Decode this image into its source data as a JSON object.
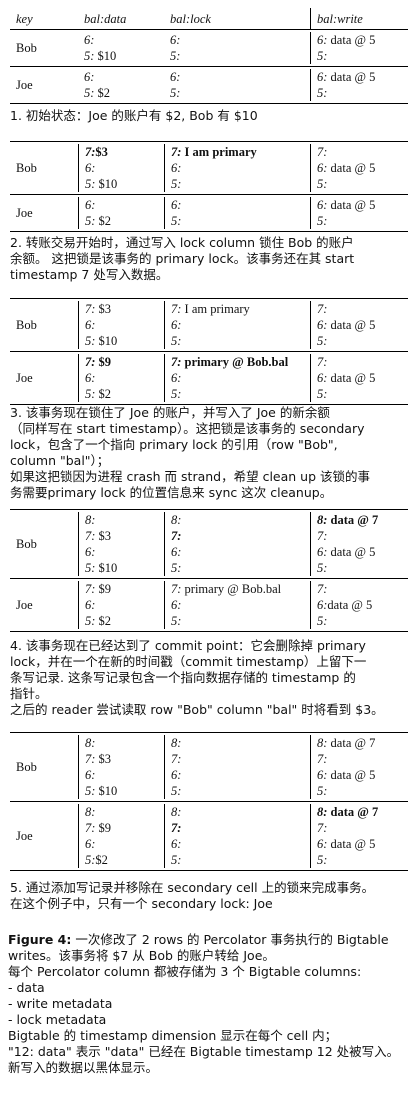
{
  "headers": [
    "key",
    "bal:data",
    "bal:lock",
    "bal:write"
  ],
  "tables": [
    {
      "rows": [
        {
          "key": "Bob",
          "data": [
            {
              "ts": "6:",
              "v": ""
            },
            {
              "ts": "5:",
              "v": " $10"
            }
          ],
          "lock": [
            {
              "ts": "6:",
              "v": ""
            },
            {
              "ts": "5:",
              "v": ""
            }
          ],
          "write": [
            {
              "ts": "6:",
              "v": " data @ 5"
            },
            {
              "ts": "5:",
              "v": ""
            }
          ]
        },
        {
          "key": "Joe",
          "data": [
            {
              "ts": "6:",
              "v": ""
            },
            {
              "ts": "5:",
              "v": " $2"
            }
          ],
          "lock": [
            {
              "ts": "6:",
              "v": ""
            },
            {
              "ts": "5:",
              "v": ""
            }
          ],
          "write": [
            {
              "ts": "6:",
              "v": " data @ 5"
            },
            {
              "ts": "5:",
              "v": ""
            }
          ]
        }
      ],
      "caption": [
        "1. 初始状态：Joe 的账户有 $2, Bob 有 $10"
      ]
    },
    {
      "rows": [
        {
          "key": "Bob",
          "data": [
            {
              "ts": "7:",
              "v": "$3",
              "bold": true
            },
            {
              "ts": "6:",
              "v": ""
            },
            {
              "ts": "5:",
              "v": " $10"
            }
          ],
          "lock": [
            {
              "ts": "7:",
              "v": " I am primary",
              "bold": true
            },
            {
              "ts": "6:",
              "v": ""
            },
            {
              "ts": "5:",
              "v": ""
            }
          ],
          "write": [
            {
              "ts": "7:",
              "v": ""
            },
            {
              "ts": "6:",
              "v": " data @ 5"
            },
            {
              "ts": "5:",
              "v": ""
            }
          ]
        },
        {
          "key": "Joe",
          "data": [
            {
              "ts": "6:",
              "v": ""
            },
            {
              "ts": "5:",
              "v": " $2"
            }
          ],
          "lock": [
            {
              "ts": "6:",
              "v": ""
            },
            {
              "ts": "5:",
              "v": ""
            }
          ],
          "write": [
            {
              "ts": "6:",
              "v": " data @ 5"
            },
            {
              "ts": "5:",
              "v": ""
            }
          ]
        }
      ],
      "caption": [
        "2. 转账交易开始时，通过写入 lock column 锁住 Bob 的账户",
        "余额。 这把锁是该事务的 primary lock。该事务还在其 start",
        "timestamp 7 处写入数据。"
      ]
    },
    {
      "rows": [
        {
          "key": "Bob",
          "data": [
            {
              "ts": "7:",
              "v": " $3"
            },
            {
              "ts": "6:",
              "v": ""
            },
            {
              "ts": "5:",
              "v": " $10"
            }
          ],
          "lock": [
            {
              "ts": "7:",
              "v": " I am primary"
            },
            {
              "ts": "6:",
              "v": ""
            },
            {
              "ts": "5:",
              "v": ""
            }
          ],
          "write": [
            {
              "ts": "7:",
              "v": ""
            },
            {
              "ts": "6:",
              "v": " data @ 5"
            },
            {
              "ts": "5:",
              "v": ""
            }
          ]
        },
        {
          "key": "Joe",
          "data": [
            {
              "ts": "7:",
              "v": " $9",
              "bold": true
            },
            {
              "ts": "6:",
              "v": ""
            },
            {
              "ts": "5:",
              "v": " $2"
            }
          ],
          "lock": [
            {
              "ts": "7:",
              "v": " primary @ Bob.bal",
              "bold": true
            },
            {
              "ts": "6:",
              "v": ""
            },
            {
              "ts": "5:",
              "v": ""
            }
          ],
          "write": [
            {
              "ts": "7:",
              "v": ""
            },
            {
              "ts": "6:",
              "v": " data @ 5"
            },
            {
              "ts": "5:",
              "v": ""
            }
          ]
        }
      ],
      "caption": [
        "3. 该事务现在锁住了 Joe 的账户，并写入了 Joe 的新余额",
        "（同样写在 start timestamp）。这把锁是该事务的 secondary",
        "lock，包含了一个指向 primary lock 的引用（row \"Bob\",",
        "column \"bal\"）；",
        "如果这把锁因为进程 crash 而 strand，希望 clean up 该锁的事",
        "务需要primary lock 的位置信息来 sync 这次 cleanup。"
      ]
    },
    {
      "rows": [
        {
          "key": "Bob",
          "data": [
            {
              "ts": "8:",
              "v": ""
            },
            {
              "ts": "7:",
              "v": " $3"
            },
            {
              "ts": "6:",
              "v": ""
            },
            {
              "ts": "5:",
              "v": " $10"
            }
          ],
          "lock": [
            {
              "ts": "8:",
              "v": ""
            },
            {
              "ts": "7:",
              "v": "",
              "boldts": true
            },
            {
              "ts": "6:",
              "v": ""
            },
            {
              "ts": "5:",
              "v": ""
            }
          ],
          "write": [
            {
              "ts": "8:",
              "v": " data @ 7",
              "bold": true
            },
            {
              "ts": "7:",
              "v": ""
            },
            {
              "ts": "6:",
              "v": " data @ 5"
            },
            {
              "ts": "5:",
              "v": ""
            }
          ]
        },
        {
          "key": "Joe",
          "data": [
            {
              "ts": "7:",
              "v": " $9"
            },
            {
              "ts": "6:",
              "v": ""
            },
            {
              "ts": "5:",
              "v": " $2"
            }
          ],
          "lock": [
            {
              "ts": "7:",
              "v": " primary @ Bob.bal"
            },
            {
              "ts": "6:",
              "v": ""
            },
            {
              "ts": "5:",
              "v": ""
            }
          ],
          "write": [
            {
              "ts": "7:",
              "v": ""
            },
            {
              "ts": "6:",
              "v": "data @ 5"
            },
            {
              "ts": "5:",
              "v": ""
            }
          ]
        }
      ],
      "caption": [
        "4. 该事务现在已经达到了 commit point：它会删除掉 primary",
        "lock，并在一个在新的时间戳（commit timestamp）上留下一",
        "条写记录. 这条写记录包含一个指向数据存储的 timestamp 的",
        "指针。",
        "之后的 reader 尝试读取 row \"Bob\" column \"bal\" 时将看到 $3。"
      ]
    },
    {
      "rows": [
        {
          "key": "Bob",
          "data": [
            {
              "ts": "8:",
              "v": ""
            },
            {
              "ts": "7:",
              "v": " $3"
            },
            {
              "ts": "6:",
              "v": ""
            },
            {
              "ts": "5:",
              "v": " $10"
            }
          ],
          "lock": [
            {
              "ts": "8:",
              "v": ""
            },
            {
              "ts": "7:",
              "v": ""
            },
            {
              "ts": "6:",
              "v": ""
            },
            {
              "ts": "5:",
              "v": ""
            }
          ],
          "write": [
            {
              "ts": "8:",
              "v": " data @ 7"
            },
            {
              "ts": "7:",
              "v": ""
            },
            {
              "ts": "6:",
              "v": " data @ 5"
            },
            {
              "ts": "5:",
              "v": ""
            }
          ]
        },
        {
          "key": "Joe",
          "data": [
            {
              "ts": "8:",
              "v": ""
            },
            {
              "ts": "7:",
              "v": " $9"
            },
            {
              "ts": "6:",
              "v": ""
            },
            {
              "ts": "5:",
              "v": "$2"
            }
          ],
          "lock": [
            {
              "ts": "8:",
              "v": ""
            },
            {
              "ts": "7:",
              "v": "",
              "boldts": true
            },
            {
              "ts": "6:",
              "v": ""
            },
            {
              "ts": "5:",
              "v": ""
            }
          ],
          "write": [
            {
              "ts": "8:",
              "v": " data @ 7",
              "bold": true
            },
            {
              "ts": "7:",
              "v": ""
            },
            {
              "ts": "6:",
              "v": " data @ 5"
            },
            {
              "ts": "5:",
              "v": ""
            }
          ]
        }
      ],
      "caption": [
        "5. 通过添加写记录并移除在 secondary cell 上的锁来完成事务。",
        "在这个例子中，只有一个 secondary lock: Joe"
      ]
    }
  ],
  "figure": {
    "label": "Figure 4:",
    "lines": [
      " 一次修改了 2 rows 的 Percolator 事务执行的 Bigtable",
      "writes。该事务将 $7 从 Bob 的账户转给 Joe。",
      "每个 Percolator column 都被存储为 3 个 Bigtable columns:",
      "- data",
      "- write metadata",
      "- lock metadata",
      "Bigtable 的 timestamp dimension 显示在每个 cell 内；",
      "\"12: data\" 表示 \"data\" 已经在 Bigtable timestamp 12 处被写入。",
      "新写入的数据以黑体显示。"
    ]
  }
}
